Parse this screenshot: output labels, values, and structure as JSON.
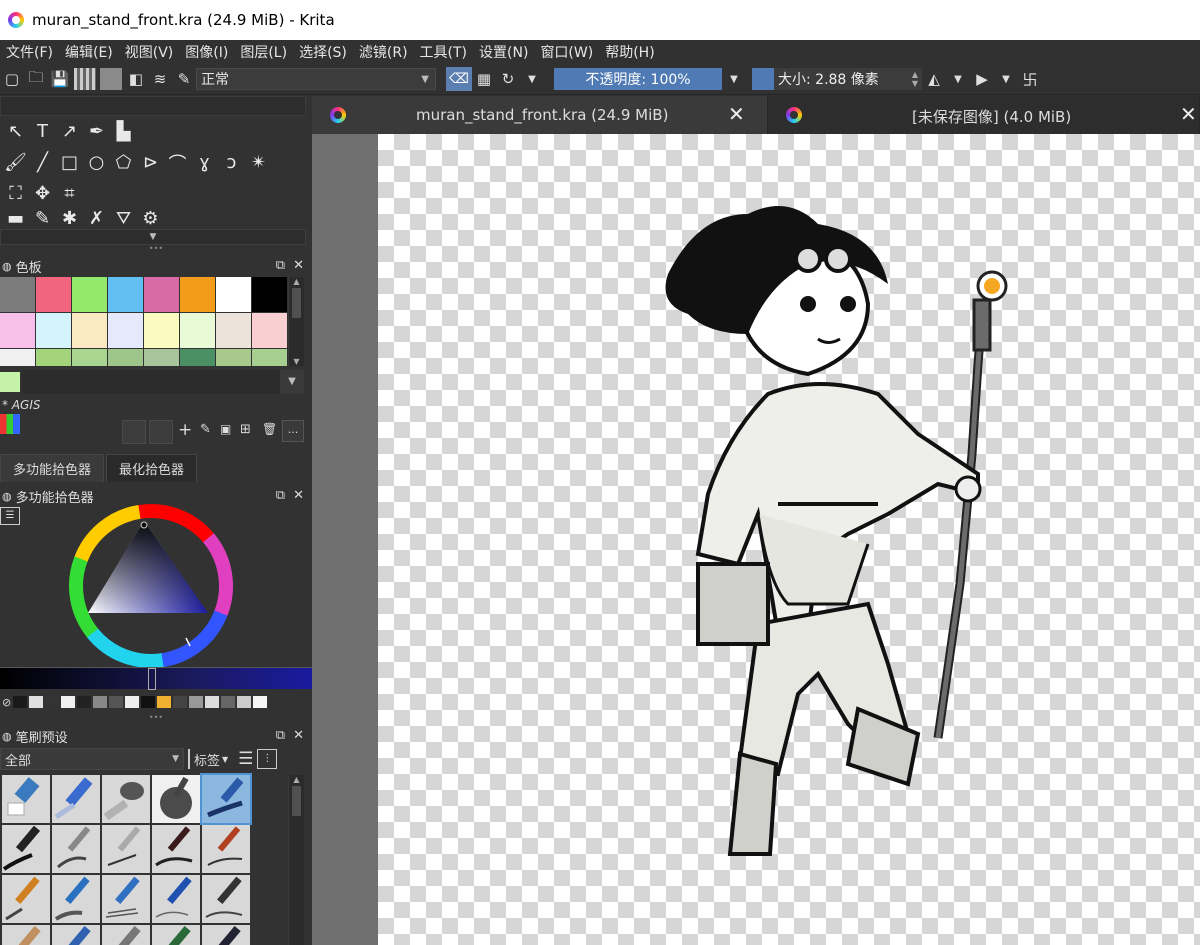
{
  "window": {
    "title": "muran_stand_front.kra (24.9 MiB)  - Krita"
  },
  "menu": [
    "文件(F)",
    "编辑(E)",
    "视图(V)",
    "图像(I)",
    "图层(L)",
    "选择(S)",
    "滤镜(R)",
    "工具(T)",
    "设置(N)",
    "窗口(W)",
    "帮助(H)"
  ],
  "toolbar": {
    "blend_mode": "正常",
    "opacity_label": "不透明度:  100%",
    "size_label": "大小:  2.88 像素"
  },
  "tabs": [
    {
      "label": "muran_stand_front.kra (24.9 MiB)"
    },
    {
      "label": "[未保存图像]  (4.0 MiB)"
    }
  ],
  "palette": {
    "title": "色板",
    "name": "* AGIS",
    "colors": [
      "#7c7c7c",
      "#f2657f",
      "#92e86a",
      "#62bff1",
      "#da6aa6",
      "#f39b1a",
      "#ffffff",
      "#000000",
      "#f8bfea",
      "#d5f3fb",
      "#fbe9c1",
      "#e4e9fb",
      "#fbfbc0",
      "#e8fad6",
      "#ece4da",
      "#f9cfd2",
      "#f0f0f0",
      "#a3d47b",
      "#a8d690",
      "#9ec58a",
      "#a8c49a",
      "#4b8f64",
      "#a8c98c",
      "#a7d090"
    ],
    "selected_color": "#c4f2a7"
  },
  "color_tabs": [
    "多功能拾色器",
    "最化拾色器"
  ],
  "color_picker": {
    "title": "多功能拾色器",
    "base_color": "#1a1aa0"
  },
  "brush_presets": {
    "title": "笔刷预设",
    "filter": "全部",
    "tag_label": "标签"
  }
}
